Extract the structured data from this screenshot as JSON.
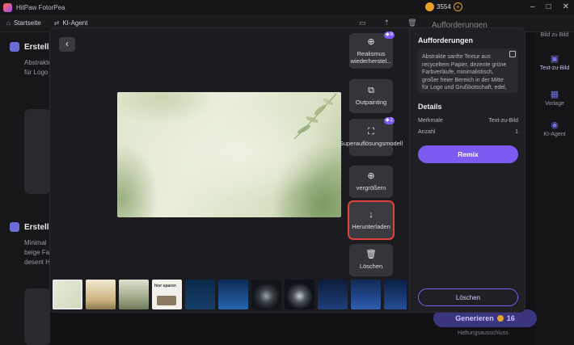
{
  "app": {
    "title": "HitPaw FotorPea",
    "coins": "3554"
  },
  "tabs": [
    {
      "label": "Startseite",
      "icon": "home-icon"
    },
    {
      "label": "KI-Agent",
      "icon": "agent-icon"
    }
  ],
  "background": {
    "right_title": "Aufforderungen",
    "items": [
      {
        "title": "Erstellu",
        "line1": "Abstrakte",
        "line2": "für Logo"
      },
      {
        "title": "Erstellu",
        "line1": "Minimal",
        "line2": "beige Fa",
        "line3": "desent H"
      }
    ],
    "rightbar": [
      "Bild zu Bild",
      "Text-zu-Bild",
      "Vorlage",
      "KI-Agent"
    ],
    "generate_label": "Generieren",
    "generate_cost": "16",
    "hint": "Haftungsausschluss"
  },
  "modal": {
    "tools": [
      {
        "label": "Realismus wiederherstel...",
        "icon": "target-icon",
        "badge": "8"
      },
      {
        "label": "Outpainting",
        "icon": "outpaint-icon",
        "badge": ""
      },
      {
        "label": "Superauflösungsmodell",
        "icon": "expand-icon",
        "badge": "2"
      },
      {
        "label": "vergrößern",
        "icon": "zoom-icon",
        "badge": ""
      },
      {
        "label": "Herunterladen",
        "icon": "download-icon",
        "badge": ""
      },
      {
        "label": "Löschen",
        "icon": "trash-icon",
        "badge": ""
      }
    ],
    "panel": {
      "title": "Aufforderungen",
      "prompt": "Abstrakte sanfte Textur aus recyceltem Papier, dezente grüne Farbverläufe, minimalistisch, großer freier Bereich in der Mitte für Logo und Grußbotschaft, edel, zurückhaltend, hochauflösend",
      "details_title": "Details",
      "details": [
        {
          "key": "Merkmale",
          "value": "Text-zu-Bild"
        },
        {
          "key": "Anzahl",
          "value": "1"
        }
      ],
      "remix_label": "Remix",
      "delete_label": "Löschen"
    },
    "thumb_text": {
      "t4": "hier sparen"
    }
  }
}
